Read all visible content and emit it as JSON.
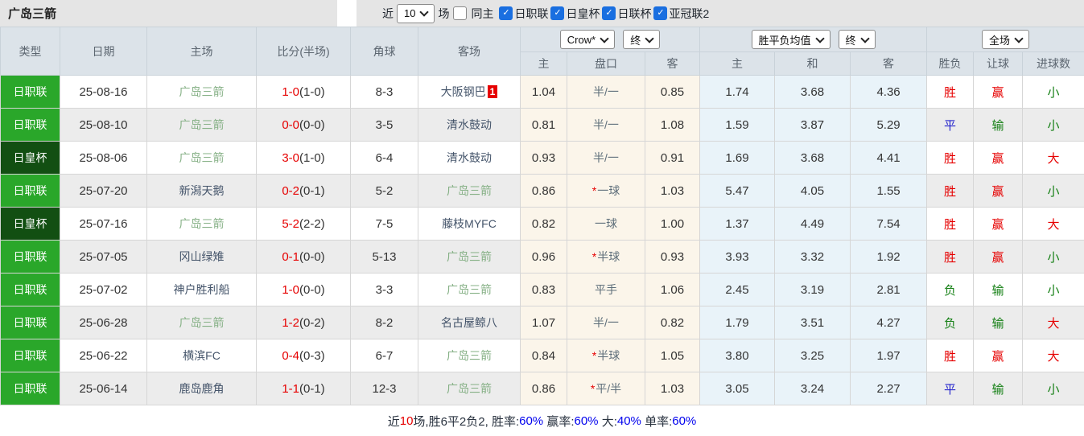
{
  "title": "广岛三箭",
  "toolbar": {
    "recent_label": "近",
    "recent_value": "10",
    "unit_label": "场",
    "same_home_label": "同主",
    "check_glyph": "✓",
    "leagues": [
      {
        "label": "日职联",
        "checked": true
      },
      {
        "label": "日皇杯",
        "checked": true
      },
      {
        "label": "日联杯",
        "checked": true
      },
      {
        "label": "亚冠联2",
        "checked": true
      }
    ]
  },
  "selects": {
    "asian_source": "Crow*",
    "asian_period": "终",
    "euro_source": "胜平负均值",
    "euro_period": "终",
    "match_scope": "全场"
  },
  "cols": {
    "type": "类型",
    "date": "日期",
    "home": "主场",
    "score": "比分(半场)",
    "corners": "角球",
    "away": "客场",
    "asian_home": "主",
    "asian_line": "盘口",
    "asian_away": "客",
    "euro_home": "主",
    "euro_draw": "和",
    "euro_away": "客",
    "result_wl": "胜负",
    "result_handicap": "让球",
    "result_goals": "进球数"
  },
  "colors": {
    "league_green": "#2aa72a",
    "cup_green": "#124f12",
    "team_highlight_green": "#85b085",
    "win_red": "#e60000",
    "draw_blue": "#2323cc",
    "lose_green": "#158015",
    "summary_blue": "#0000ee",
    "checkbox_blue": "#1a6fe0"
  },
  "rows": [
    {
      "type": "日职联",
      "type_style": "league",
      "date": "25-08-16",
      "home": "广岛三箭",
      "home_highlight": true,
      "score_ft": "1-0",
      "score_ht": "(1-0)",
      "corners": "8-3",
      "away": "大阪钢巴",
      "away_highlight": false,
      "away_badge": "1",
      "asian_home": "1.04",
      "asian_line": "半/一",
      "asian_line_star": false,
      "asian_away": "0.85",
      "euro_home": "1.74",
      "euro_draw": "3.68",
      "euro_away": "4.36",
      "result_wl": "胜",
      "result_wl_style": "red",
      "result_handicap": "赢",
      "result_handicap_style": "red",
      "result_goals": "小",
      "result_goals_style": "green"
    },
    {
      "type": "日职联",
      "type_style": "league",
      "date": "25-08-10",
      "home": "广岛三箭",
      "home_highlight": true,
      "score_ft": "0-0",
      "score_ht": "(0-0)",
      "corners": "3-5",
      "away": "清水鼓动",
      "away_highlight": false,
      "away_badge": "",
      "asian_home": "0.81",
      "asian_line": "半/一",
      "asian_line_star": false,
      "asian_away": "1.08",
      "euro_home": "1.59",
      "euro_draw": "3.87",
      "euro_away": "5.29",
      "result_wl": "平",
      "result_wl_style": "blue",
      "result_handicap": "输",
      "result_handicap_style": "green",
      "result_goals": "小",
      "result_goals_style": "green"
    },
    {
      "type": "日皇杯",
      "type_style": "cup",
      "date": "25-08-06",
      "home": "广岛三箭",
      "home_highlight": true,
      "score_ft": "3-0",
      "score_ht": "(1-0)",
      "corners": "6-4",
      "away": "清水鼓动",
      "away_highlight": false,
      "away_badge": "",
      "asian_home": "0.93",
      "asian_line": "半/一",
      "asian_line_star": false,
      "asian_away": "0.91",
      "euro_home": "1.69",
      "euro_draw": "3.68",
      "euro_away": "4.41",
      "result_wl": "胜",
      "result_wl_style": "red",
      "result_handicap": "赢",
      "result_handicap_style": "red",
      "result_goals": "大",
      "result_goals_style": "red"
    },
    {
      "type": "日职联",
      "type_style": "league",
      "date": "25-07-20",
      "home": "新潟天鹅",
      "home_highlight": false,
      "score_ft": "0-2",
      "score_ht": "(0-1)",
      "corners": "5-2",
      "away": "广岛三箭",
      "away_highlight": true,
      "away_badge": "",
      "asian_home": "0.86",
      "asian_line": "一球",
      "asian_line_star": true,
      "asian_away": "1.03",
      "euro_home": "5.47",
      "euro_draw": "4.05",
      "euro_away": "1.55",
      "result_wl": "胜",
      "result_wl_style": "red",
      "result_handicap": "赢",
      "result_handicap_style": "red",
      "result_goals": "小",
      "result_goals_style": "green"
    },
    {
      "type": "日皇杯",
      "type_style": "cup",
      "date": "25-07-16",
      "home": "广岛三箭",
      "home_highlight": true,
      "score_ft": "5-2",
      "score_ht": "(2-2)",
      "corners": "7-5",
      "away": "藤枝MYFC",
      "away_highlight": false,
      "away_badge": "",
      "asian_home": "0.82",
      "asian_line": "一球",
      "asian_line_star": false,
      "asian_away": "1.00",
      "euro_home": "1.37",
      "euro_draw": "4.49",
      "euro_away": "7.54",
      "result_wl": "胜",
      "result_wl_style": "red",
      "result_handicap": "赢",
      "result_handicap_style": "red",
      "result_goals": "大",
      "result_goals_style": "red"
    },
    {
      "type": "日职联",
      "type_style": "league",
      "date": "25-07-05",
      "home": "冈山绿雉",
      "home_highlight": false,
      "score_ft": "0-1",
      "score_ht": "(0-0)",
      "corners": "5-13",
      "away": "广岛三箭",
      "away_highlight": true,
      "away_badge": "",
      "asian_home": "0.96",
      "asian_line": "半球",
      "asian_line_star": true,
      "asian_away": "0.93",
      "euro_home": "3.93",
      "euro_draw": "3.32",
      "euro_away": "1.92",
      "result_wl": "胜",
      "result_wl_style": "red",
      "result_handicap": "赢",
      "result_handicap_style": "red",
      "result_goals": "小",
      "result_goals_style": "green"
    },
    {
      "type": "日职联",
      "type_style": "league",
      "date": "25-07-02",
      "home": "神户胜利船",
      "home_highlight": false,
      "score_ft": "1-0",
      "score_ht": "(0-0)",
      "corners": "3-3",
      "away": "广岛三箭",
      "away_highlight": true,
      "away_badge": "",
      "asian_home": "0.83",
      "asian_line": "平手",
      "asian_line_star": false,
      "asian_away": "1.06",
      "euro_home": "2.45",
      "euro_draw": "3.19",
      "euro_away": "2.81",
      "result_wl": "负",
      "result_wl_style": "green",
      "result_handicap": "输",
      "result_handicap_style": "green",
      "result_goals": "小",
      "result_goals_style": "green"
    },
    {
      "type": "日职联",
      "type_style": "league",
      "date": "25-06-28",
      "home": "广岛三箭",
      "home_highlight": true,
      "score_ft": "1-2",
      "score_ht": "(0-2)",
      "corners": "8-2",
      "away": "名古屋鲸八",
      "away_highlight": false,
      "away_badge": "",
      "asian_home": "1.07",
      "asian_line": "半/一",
      "asian_line_star": false,
      "asian_away": "0.82",
      "euro_home": "1.79",
      "euro_draw": "3.51",
      "euro_away": "4.27",
      "result_wl": "负",
      "result_wl_style": "green",
      "result_handicap": "输",
      "result_handicap_style": "green",
      "result_goals": "大",
      "result_goals_style": "red"
    },
    {
      "type": "日职联",
      "type_style": "league",
      "date": "25-06-22",
      "home": "横滨FC",
      "home_highlight": false,
      "score_ft": "0-4",
      "score_ht": "(0-3)",
      "corners": "6-7",
      "away": "广岛三箭",
      "away_highlight": true,
      "away_badge": "",
      "asian_home": "0.84",
      "asian_line": "半球",
      "asian_line_star": true,
      "asian_away": "1.05",
      "euro_home": "3.80",
      "euro_draw": "3.25",
      "euro_away": "1.97",
      "result_wl": "胜",
      "result_wl_style": "red",
      "result_handicap": "赢",
      "result_handicap_style": "red",
      "result_goals": "大",
      "result_goals_style": "red"
    },
    {
      "type": "日职联",
      "type_style": "league",
      "date": "25-06-14",
      "home": "鹿岛鹿角",
      "home_highlight": false,
      "score_ft": "1-1",
      "score_ht": "(0-1)",
      "corners": "12-3",
      "away": "广岛三箭",
      "away_highlight": true,
      "away_badge": "",
      "asian_home": "0.86",
      "asian_line": "平/半",
      "asian_line_star": true,
      "asian_away": "1.03",
      "euro_home": "3.05",
      "euro_draw": "3.24",
      "euro_away": "2.27",
      "result_wl": "平",
      "result_wl_style": "blue",
      "result_handicap": "输",
      "result_handicap_style": "green",
      "result_goals": "小",
      "result_goals_style": "green"
    }
  ],
  "summary": {
    "segments": [
      {
        "text": "近",
        "style": "dark"
      },
      {
        "text": "10",
        "style": "red"
      },
      {
        "text": "场,胜6平2负2, 胜率:",
        "style": "dark"
      },
      {
        "text": "60%",
        "style": "blue"
      },
      {
        "text": " 赢率:",
        "style": "dark"
      },
      {
        "text": "60%",
        "style": "blue"
      },
      {
        "text": " 大:",
        "style": "dark"
      },
      {
        "text": "40%",
        "style": "blue"
      },
      {
        "text": " 单率:",
        "style": "dark"
      },
      {
        "text": "60%",
        "style": "blue"
      }
    ]
  }
}
